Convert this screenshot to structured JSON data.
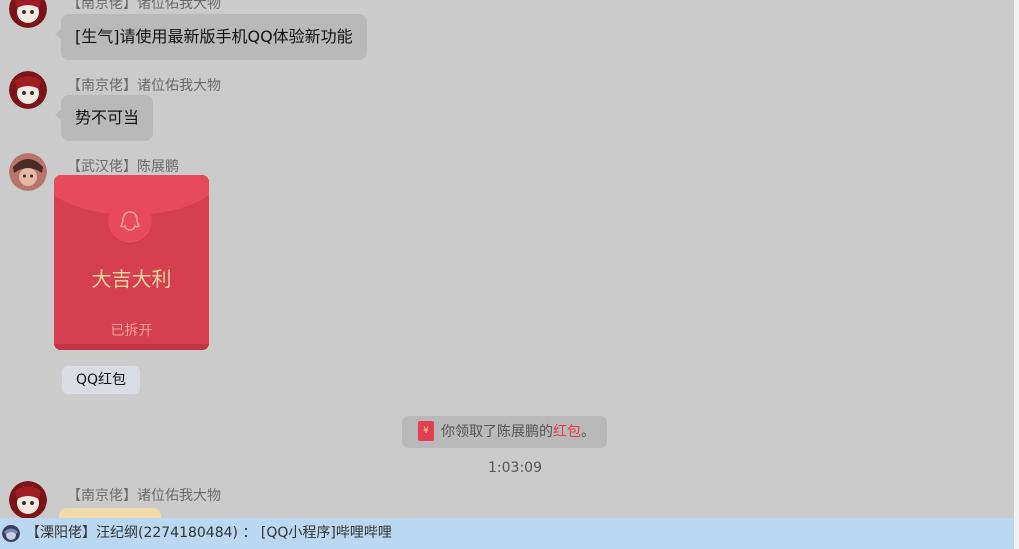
{
  "messages": [
    {
      "sender": "【南京佬】诸位佑我大物",
      "text": "[生气]请使用最新版手机QQ体验新功能"
    },
    {
      "sender": "【南京佬】诸位佑我大物",
      "text": "势不可当"
    },
    {
      "sender": "【武汉佬】陈展鹏",
      "red_packet": {
        "title": "大吉大利",
        "status": "已拆开",
        "tag": "QQ红包"
      }
    }
  ],
  "system_notice": {
    "prefix": "你领取了陈展鹏的",
    "link": "红包",
    "suffix": "。"
  },
  "timestamp": "1:03:09",
  "last_message": {
    "sender": "【南京佬】诸位佑我大物"
  },
  "notification_bar": {
    "text": "【溧阳佬】汪纪纲(2274180484) ： [QQ小程序]哔哩哔哩"
  },
  "colors": {
    "background": "#cbcbcb",
    "bubble": "#b9b9b9",
    "red_packet": "#d63f4f",
    "accent_red": "#e53b4a",
    "notification_bar": "#bbd8f2"
  }
}
